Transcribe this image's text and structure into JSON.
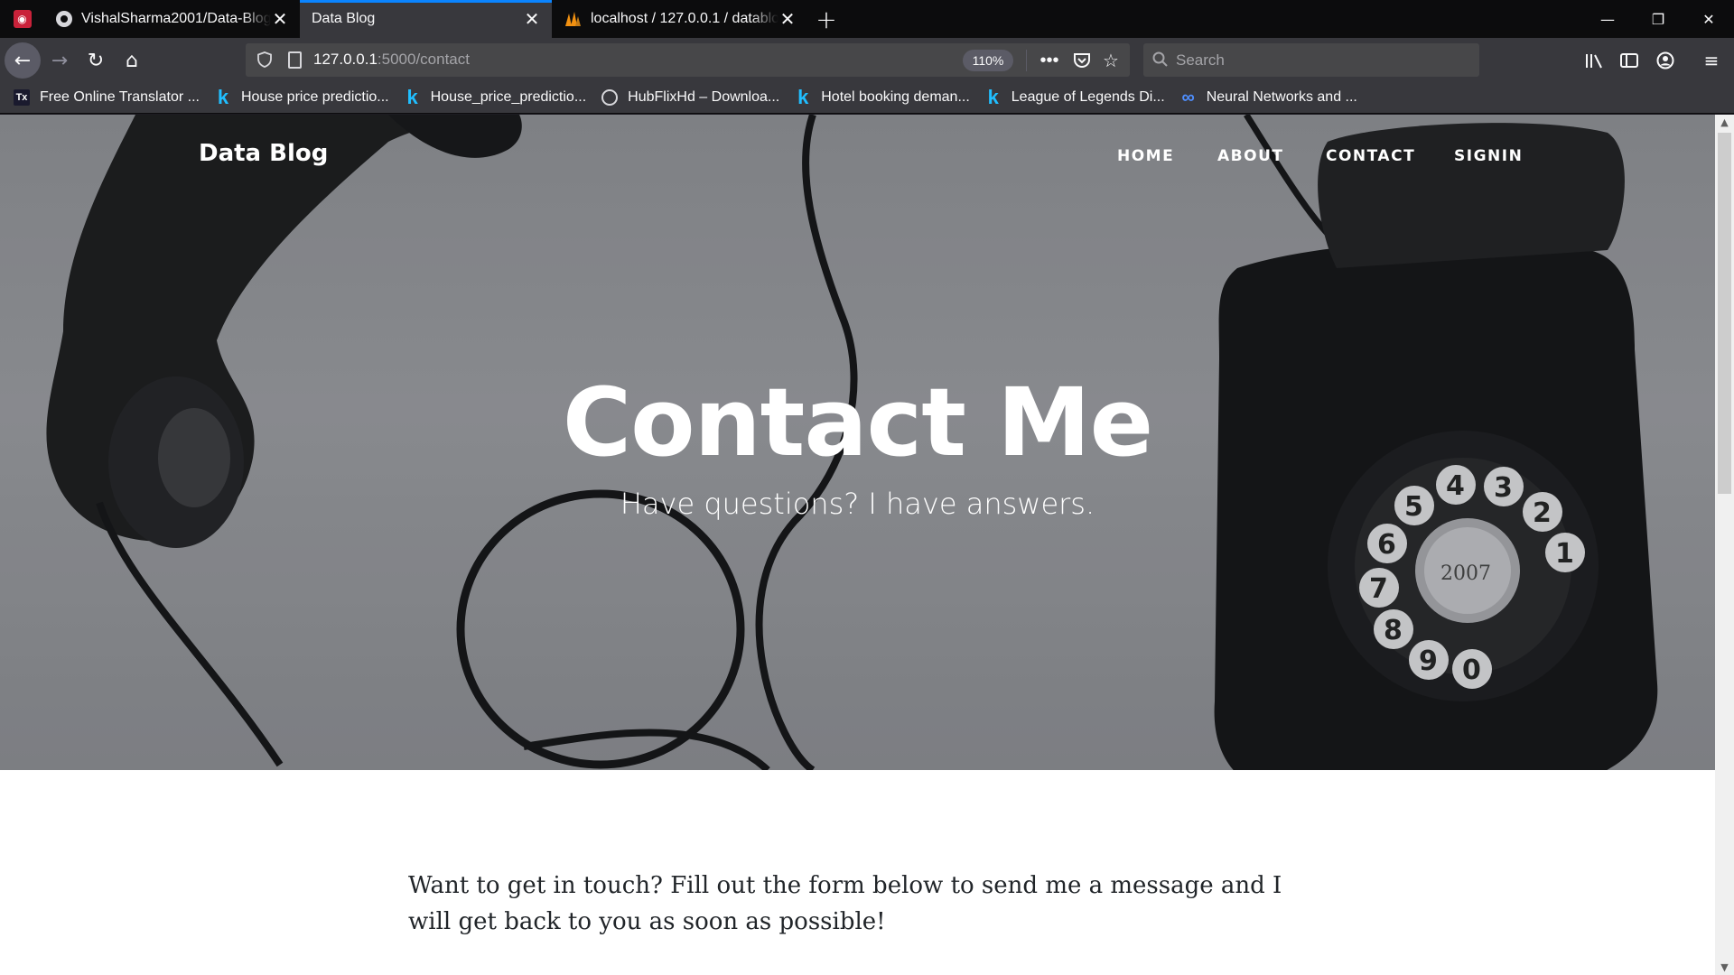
{
  "browser": {
    "tabs": [
      {
        "title": "VishalSharma2001/Data-Blog-",
        "favicon": "github-icon",
        "active": false
      },
      {
        "title": "Data Blog",
        "favicon": "none",
        "active": true
      },
      {
        "title": "localhost / 127.0.0.1 / datablog",
        "favicon": "phpmyadmin-icon",
        "active": false
      }
    ],
    "url_host": "127.0.0.1",
    "url_path": ":5000/contact",
    "zoom": "110%",
    "search_placeholder": "Search",
    "bookmarks": [
      {
        "label": "Free Online Translator ...",
        "icon": "translator-icon"
      },
      {
        "label": "House price predictio...",
        "icon": "kaggle-icon"
      },
      {
        "label": "House_price_predictio...",
        "icon": "kaggle-icon"
      },
      {
        "label": "HubFlixHd – Downloa...",
        "icon": "globe-icon"
      },
      {
        "label": "Hotel booking deman...",
        "icon": "kaggle-icon"
      },
      {
        "label": "League of Legends Di...",
        "icon": "kaggle-icon"
      },
      {
        "label": "Neural Networks and ...",
        "icon": "infinity-icon"
      }
    ],
    "colors": {
      "accent": "#0a84ff",
      "toolbar": "#38383d",
      "tabstrip": "#0c0c0d"
    }
  },
  "site": {
    "brand": "Data Blog",
    "nav": {
      "home": "HOME",
      "about": "ABOUT",
      "contact": "CONTACT",
      "signin": "SIGNIN"
    },
    "hero": {
      "title": "Contact Me",
      "subtitle": "Have questions? I have answers."
    },
    "intro": "Want to get in touch? Fill out the form below to send me a message and I will get back to you as soon as possible!"
  }
}
